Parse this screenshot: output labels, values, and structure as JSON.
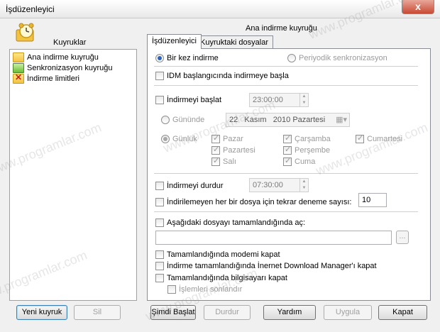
{
  "window": {
    "title": "İşdüzenleyici",
    "close_glyph": "x"
  },
  "left_panel": {
    "heading": "Kuyruklar",
    "items": [
      {
        "label": "Ana indirme kuyruğu",
        "icon": "folder-icon"
      },
      {
        "label": "Senkronizasyon kuyruğu",
        "icon": "green-folder-icon"
      },
      {
        "label": "İndirme limitleri",
        "icon": "limit-folder-icon"
      }
    ],
    "new_queue_button": "Yeni kuyruk",
    "delete_button": "Sil"
  },
  "main": {
    "group_title": "Ana indirme kuyruğu",
    "tabs": [
      {
        "label": "İşdüzenleyici"
      },
      {
        "label": "Kuyruktaki dosyalar"
      }
    ],
    "once_radio": "Bir kez indirme",
    "periodic_radio": "Periyodik senkronizasyon",
    "start_on_idm": "IDM başlangıcında indirmeye başla",
    "start_download": "İndirmeyi başlat",
    "start_time": "23:00:00",
    "on_day_radio": "Gününde",
    "date": {
      "day": "22",
      "month": "Kasım",
      "year": "2010",
      "weekday": "Pazartesi"
    },
    "daily_radio": "Günlük",
    "days": [
      "Pazar",
      "Çarşamba",
      "Cumartesi",
      "Pazartesi",
      "Perşembe",
      "Salı",
      "Cuma"
    ],
    "stop_download": "İndirmeyi durdur",
    "stop_time": "07:30:00",
    "retry_label": "İndirilemeyen her bir dosya için tekrar deneme sayısı:",
    "retry_count": "10",
    "open_file_label": "Aşağıdaki dosyayı tamamlandığında  aç:",
    "open_file_value": "",
    "browse_button": "...",
    "hangup_modem": "Tamamlandığında modemi kapat",
    "exit_idm": "İndirme tamamlandığında İnernet Download Manager'ı kapat",
    "shutdown": "Tamamlandığında bilgisayarı kapat",
    "force_processes": "İşlemleri sonlandır"
  },
  "footer": {
    "start_now": "Şimdi Başlat",
    "stop": "Durdur",
    "help": "Yardım",
    "apply": "Uygula",
    "close": "Kapat"
  },
  "watermark": "www.programlar.com"
}
